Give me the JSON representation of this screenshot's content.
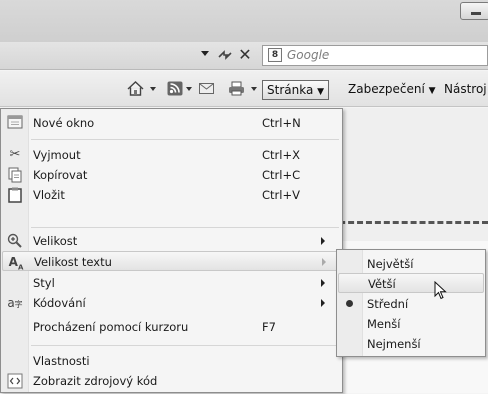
{
  "toolbar": {
    "search_placeholder": "Google",
    "search_logo": "8"
  },
  "commandbar": {
    "page_label": "Stránka",
    "security_label": "Zabezpečení",
    "tools_label": "Nástroj"
  },
  "page_menu": {
    "items": [
      {
        "icon": "new-window-icon",
        "label": "Nové okno",
        "shortcut": "Ctrl+N"
      },
      {
        "icon": "scissors-icon",
        "label": "Vyjmout",
        "shortcut": "Ctrl+X"
      },
      {
        "icon": "copy-icon",
        "label": "Kopírovat",
        "shortcut": "Ctrl+C"
      },
      {
        "icon": "paste-icon",
        "label": "Vložit",
        "shortcut": "Ctrl+V"
      },
      {
        "icon": "zoom-icon",
        "label": "Velikost",
        "submenu": true
      },
      {
        "icon": "text-size-icon",
        "label": "Velikost textu",
        "submenu": true
      },
      {
        "label": "Styl",
        "submenu": true
      },
      {
        "icon": "encoding-icon",
        "label": "Kódování",
        "submenu": true
      },
      {
        "label": "Procházení pomocí kurzoru",
        "shortcut": "F7"
      },
      {
        "label": "Vlastnosti"
      },
      {
        "icon": "view-source-icon",
        "label": "Zobrazit zdrojový kód"
      }
    ]
  },
  "text_size_submenu": {
    "items": [
      "Největší",
      "Větší",
      "Střední",
      "Menší",
      "Nejmenší"
    ],
    "selected": "Střední",
    "highlighted": "Větší"
  }
}
